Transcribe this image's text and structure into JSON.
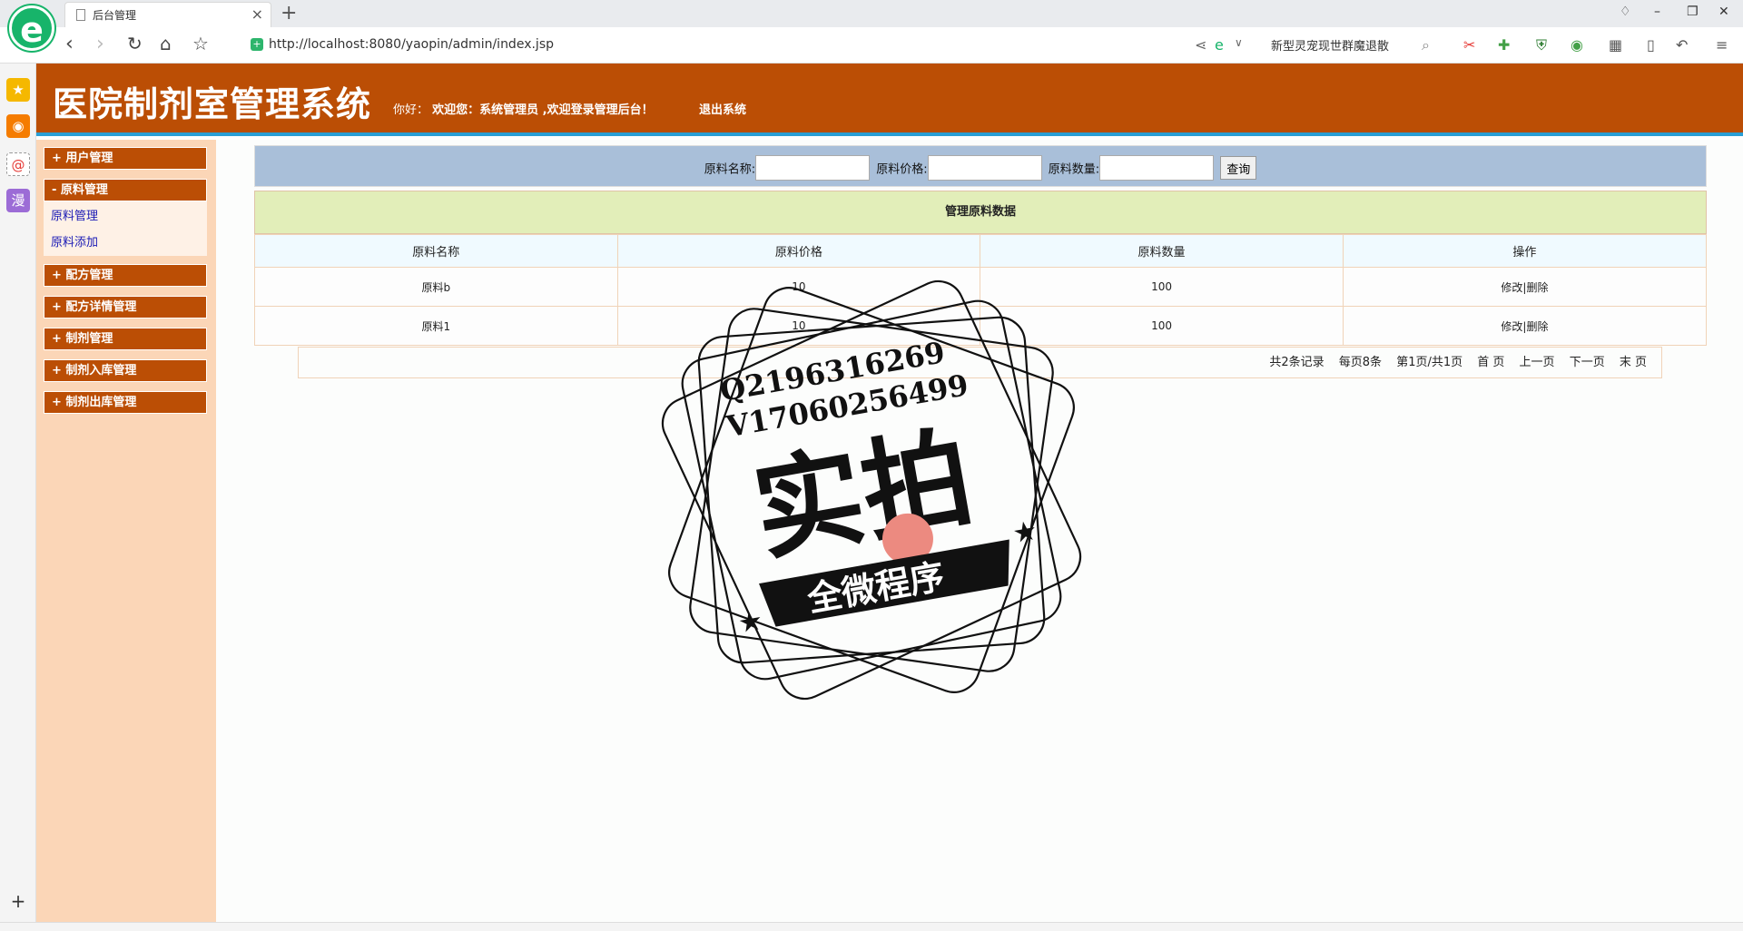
{
  "browser": {
    "tab_title": "后台管理",
    "url": "http://localhost:8080/yaopin/admin/index.jsp",
    "search_text": "新型灵宠现世群魔退散"
  },
  "header": {
    "title": "医院制剂室管理系统",
    "greeting_prefix": "你好：",
    "greeting_text": "欢迎您：系统管理员  ,欢迎登录管理后台！",
    "logout": "退出系统"
  },
  "sidebar": {
    "menus": [
      {
        "label": "+ 用户管理"
      },
      {
        "label": "- 原料管理"
      },
      {
        "label": "+ 配方管理"
      },
      {
        "label": "+ 配方详情管理"
      },
      {
        "label": "+ 制剂管理"
      },
      {
        "label": "+ 制剂入库管理"
      },
      {
        "label": "+ 制剂出库管理"
      }
    ],
    "submenu": [
      "原料管理",
      "原料添加"
    ]
  },
  "search": {
    "name_label": "原料名称:",
    "price_label": "原料价格:",
    "qty_label": "原料数量:",
    "button": "查询"
  },
  "table": {
    "title": "管理原料数据",
    "headers": [
      "原料名称",
      "原料价格",
      "原料数量",
      "操作"
    ],
    "rows": [
      {
        "name": "原料b",
        "price": "10",
        "qty": "100"
      },
      {
        "name": "原料1",
        "price": "10",
        "qty": "100"
      }
    ],
    "edit": "修改",
    "sep": "|",
    "delete": "删除"
  },
  "pager": {
    "total": "共2条记录",
    "per_page": "每页8条",
    "page_info": "第1页/共1页",
    "first": "首 页",
    "prev": "上一页",
    "next": "下一页",
    "last": "末 页"
  },
  "watermark": {
    "line1": "Q2196316269",
    "line2": "V17060256499",
    "main": "实拍",
    "banner": "全微程序"
  },
  "colors": {
    "header_bg": "#bb4e05",
    "sidebar_bg": "#fbd6b7",
    "search_bg": "#a9bfd9",
    "title_bg": "#e2eeb9"
  }
}
